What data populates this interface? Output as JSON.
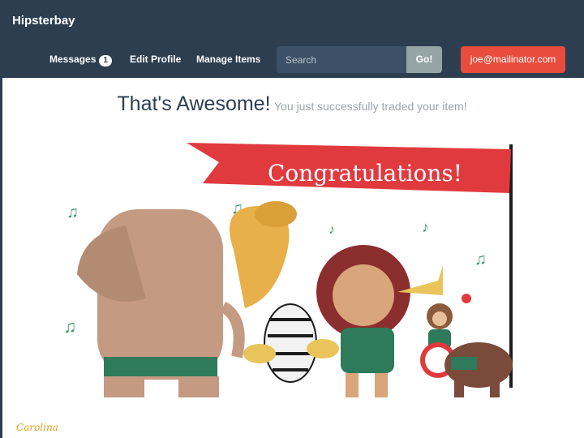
{
  "navbar": {
    "brand": "Hipsterbay",
    "messages_label": "Messages",
    "messages_count": "1",
    "edit_profile_label": "Edit Profile",
    "manage_items_label": "Manage Items",
    "search_placeholder": "Search",
    "go_label": "Go!",
    "user_email": "joe@mailinator.com"
  },
  "content": {
    "headline": "That's Awesome!",
    "subheadline": "You just successfully traded your item!",
    "banner_text": "Congratulations!",
    "signature": "Carolina"
  },
  "colors": {
    "navbar_bg": "#2c3e50",
    "user_button": "#e74c3c",
    "go_button": "#95a5a6",
    "banner_red": "#e03a3e"
  }
}
